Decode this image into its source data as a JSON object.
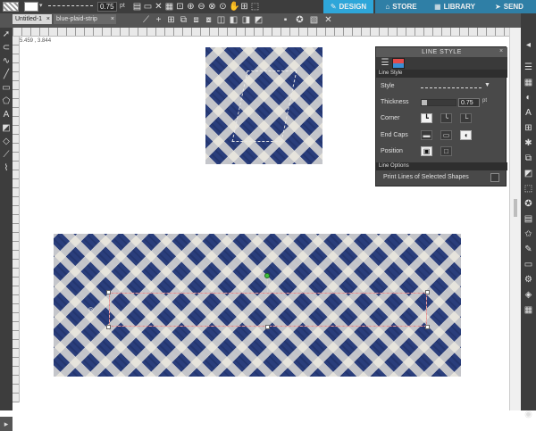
{
  "toolbar": {
    "thickness_value": "0.75",
    "thickness_unit": "pt",
    "icons": [
      "new-file-icon",
      "open-icon",
      "save-icon",
      "print-icon",
      "cut-icon",
      "copy-icon",
      "paste-icon",
      "undo-icon",
      "redo-icon",
      "group-icon",
      "ungroup-icon",
      "move-icon",
      "rotate-icon",
      "scale-icon",
      "zoom-in-icon",
      "zoom-out-icon",
      "zoom-selection-icon",
      "zoom-fit-icon",
      "pan-icon",
      "add-page-icon",
      "select-all-icon",
      "line-tool-icon",
      "crosshair-icon",
      "align-icon",
      "duplicate-icon",
      "mirror-icon",
      "replicate-icon",
      "weld-icon",
      "subtract-icon",
      "intersect-icon",
      "offset-icon",
      "star-icon",
      "delete-icon"
    ]
  },
  "nav": {
    "design": "DESIGN",
    "store": "STORE",
    "library": "LIBRARY",
    "send": "SEND",
    "active": "design"
  },
  "tabs": [
    {
      "label": "Untitled-1",
      "active": true
    },
    {
      "label": "blue-plaid-strip",
      "active": false
    }
  ],
  "coordinates": "5.459 , 3.844",
  "line_style_panel": {
    "title": "LINE STYLE",
    "section_label": "Line Style",
    "style_label": "Style",
    "thickness_label": "Thickness",
    "thickness_value": "0.75",
    "thickness_unit": "pt",
    "corner_label": "Corner",
    "end_caps_label": "End Caps",
    "position_label": "Position",
    "options_section": "Line Options",
    "print_lines_label": "Print Lines of Selected Shapes",
    "print_lines_checked": false
  },
  "colors": {
    "toolbar_bg": "#3d3d3d",
    "design_tab": "#2ea6d9",
    "nav_tab": "#2f7fa6",
    "plaid_blue": "#2a3e7c",
    "plaid_cream": "#f0ece1"
  }
}
